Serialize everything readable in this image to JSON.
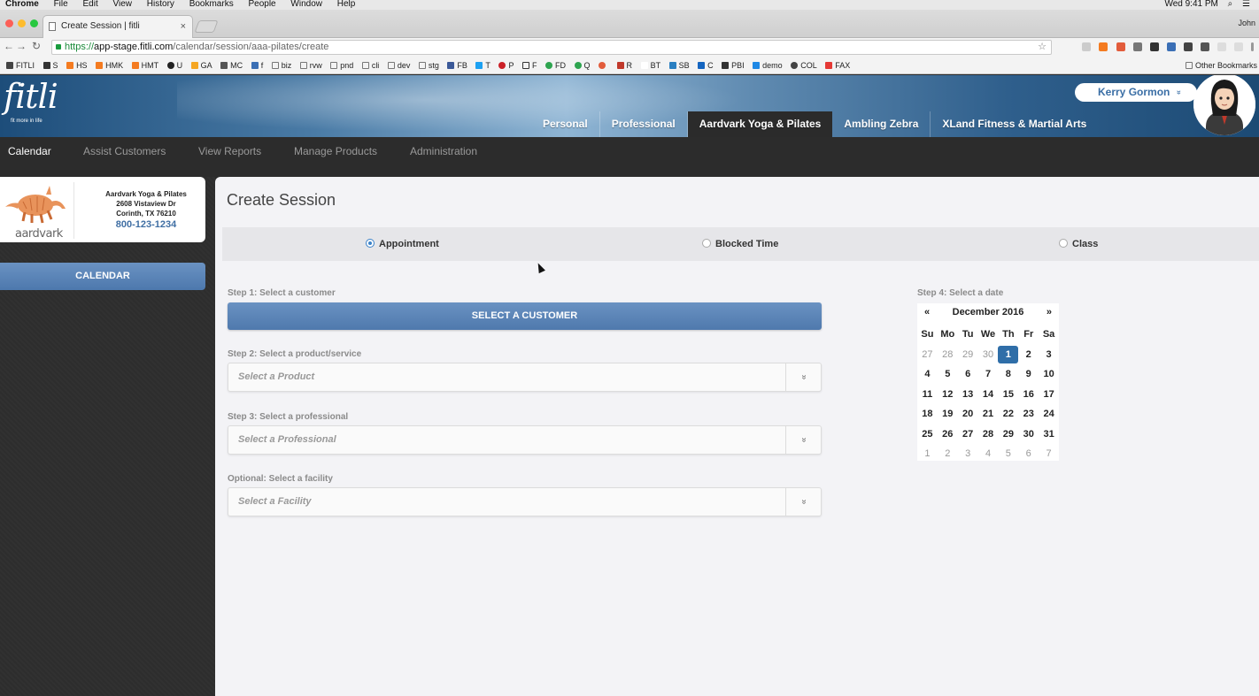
{
  "macbar": {
    "apple": "",
    "app": "Chrome",
    "menus": [
      "File",
      "Edit",
      "View",
      "History",
      "Bookmarks",
      "People",
      "Window",
      "Help"
    ],
    "clock": "Wed 9:41 PM"
  },
  "browser": {
    "tab_title": "Create Session | fitli",
    "tab_close": "×",
    "profile": "John",
    "url_scheme": "https://",
    "url_host": "app-stage.fitli.com",
    "url_path": "/calendar/session/aaa-pilates/create",
    "bookmarks": [
      "FITLI",
      "S",
      "HS",
      "HMK",
      "HMT",
      "U",
      "GA",
      "MC",
      "f",
      "biz",
      "rvw",
      "pnd",
      "cli",
      "dev",
      "stg",
      "FB",
      "T",
      "P",
      "F",
      "FD",
      "Q",
      "",
      "R",
      "BT",
      "SB",
      "C",
      "PBI",
      "demo",
      "COL",
      "FAX"
    ],
    "other_bookmarks": "Other Bookmarks"
  },
  "header": {
    "logo": "fitli",
    "logo_tagline": "fit more in life",
    "org_tabs": [
      "Personal",
      "Professional",
      "Aardvark Yoga & Pilates",
      "Ambling Zebra",
      "XLand Fitness & Martial Arts"
    ],
    "active_org_tab": "Aardvark Yoga & Pilates",
    "user_name": "Kerry Gormon",
    "user_chevron": "»"
  },
  "subnav": {
    "items": [
      "Calendar",
      "Assist Customers",
      "View Reports",
      "Manage Products",
      "Administration"
    ],
    "active": "Calendar"
  },
  "business": {
    "logo_text": "aardvark",
    "name": "Aardvark Yoga & Pilates",
    "address1": "2608 Vistaview Dr",
    "address2": "Corinth, TX 76210",
    "phone": "800-123-1234"
  },
  "sidebar": {
    "calendar_button": "CALENDAR"
  },
  "page": {
    "title": "Create Session",
    "session_types": [
      {
        "label": "Appointment",
        "selected": true
      },
      {
        "label": "Blocked Time",
        "selected": false
      },
      {
        "label": "Class",
        "selected": false
      }
    ],
    "step1_label": "Step 1: Select a customer",
    "select_customer_button": "SELECT A CUSTOMER",
    "step2_label": "Step 2: Select a product/service",
    "product_placeholder": "Select a Product",
    "step3_label": "Step 3: Select a professional",
    "professional_placeholder": "Select a Professional",
    "facility_label": "Optional: Select a facility",
    "facility_placeholder": "Select a Facility",
    "dropdown_arrow": "»",
    "step4_label": "Step 4: Select a date"
  },
  "datepicker": {
    "prev": "«",
    "next": "»",
    "month": "December 2016",
    "weekdays": [
      "Su",
      "Mo",
      "Tu",
      "We",
      "Th",
      "Fr",
      "Sa"
    ],
    "weeks": [
      [
        "27",
        "28",
        "29",
        "30",
        "1",
        "2",
        "3"
      ],
      [
        "4",
        "5",
        "6",
        "7",
        "8",
        "9",
        "10"
      ],
      [
        "11",
        "12",
        "13",
        "14",
        "15",
        "16",
        "17"
      ],
      [
        "18",
        "19",
        "20",
        "21",
        "22",
        "23",
        "24"
      ],
      [
        "25",
        "26",
        "27",
        "28",
        "29",
        "30",
        "31"
      ],
      [
        "1",
        "2",
        "3",
        "4",
        "5",
        "6",
        "7"
      ]
    ],
    "selected": "1"
  },
  "colors": {
    "brand_blue": "#4f79ad",
    "selected_day": "#2f6ea8",
    "radio_accent": "#3b82c8",
    "sidebar_bg": "#2e2e2e"
  }
}
